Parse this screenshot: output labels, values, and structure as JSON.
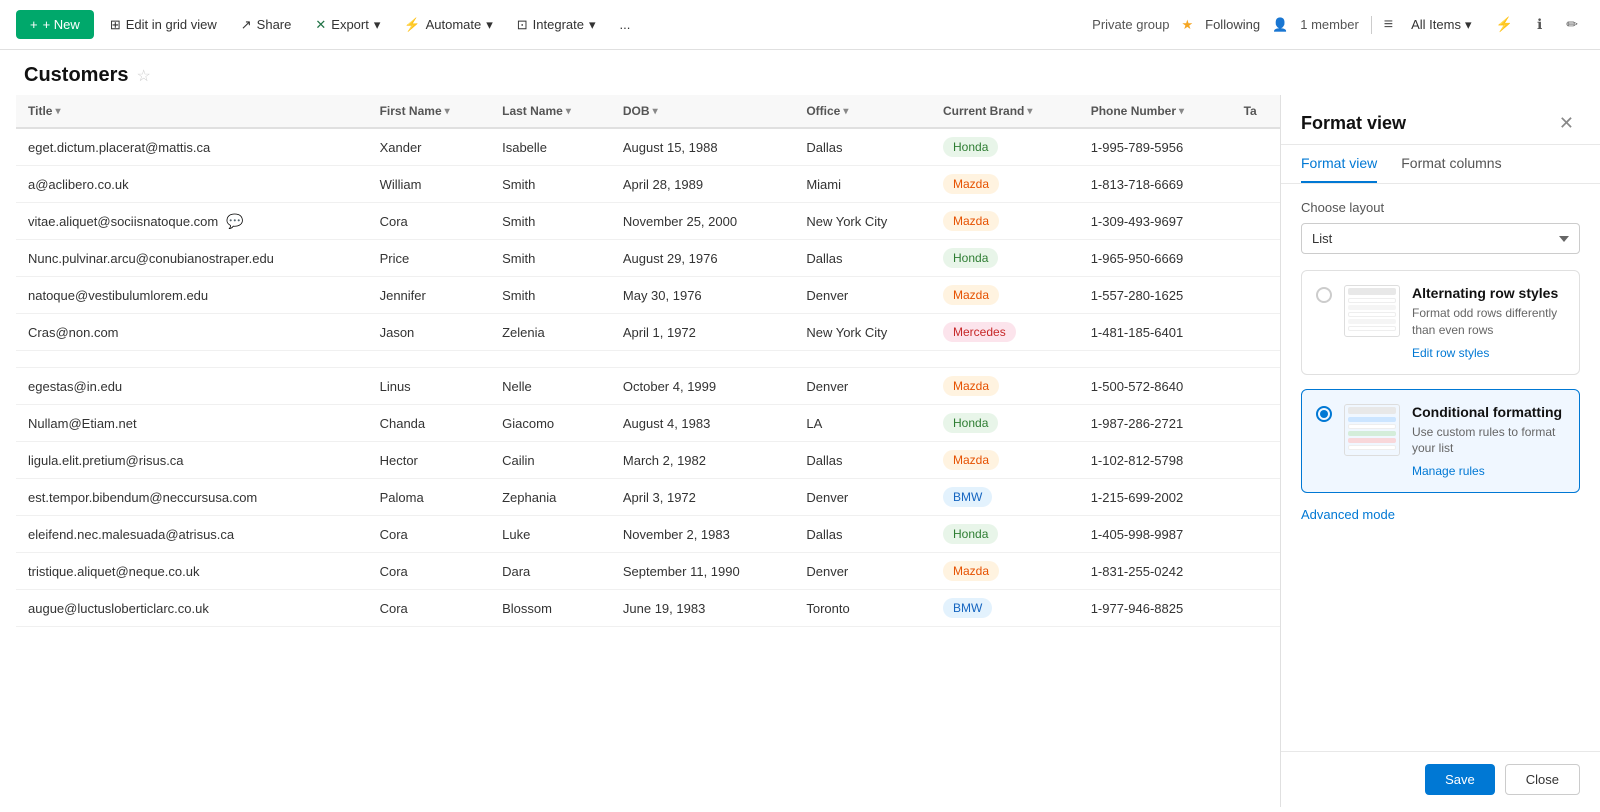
{
  "topbar": {
    "new_label": "+ New",
    "edit_grid": "Edit in grid view",
    "share": "Share",
    "export": "Export",
    "automate": "Automate",
    "integrate": "Integrate",
    "more": "...",
    "private_group": "Private group",
    "following": "Following",
    "member_count": "1 member",
    "all_items": "All Items"
  },
  "page": {
    "title": "Customers"
  },
  "columns": [
    {
      "id": "title",
      "label": "Title"
    },
    {
      "id": "first_name",
      "label": "First Name"
    },
    {
      "id": "last_name",
      "label": "Last Name"
    },
    {
      "id": "dob",
      "label": "DOB"
    },
    {
      "id": "office",
      "label": "Office"
    },
    {
      "id": "current_brand",
      "label": "Current Brand"
    },
    {
      "id": "phone_number",
      "label": "Phone Number"
    },
    {
      "id": "ta",
      "label": "Ta"
    }
  ],
  "rows": [
    {
      "title": "eget.dictum.placerat@mattis.ca",
      "first_name": "Xander",
      "last_name": "Isabelle",
      "dob": "August 15, 1988",
      "office": "Dallas",
      "brand": "Honda",
      "brand_class": "badge-honda",
      "phone": "1-995-789-5956",
      "comment": false
    },
    {
      "title": "a@aclibero.co.uk",
      "first_name": "William",
      "last_name": "Smith",
      "dob": "April 28, 1989",
      "office": "Miami",
      "brand": "Mazda",
      "brand_class": "badge-mazda",
      "phone": "1-813-718-6669",
      "comment": false
    },
    {
      "title": "vitae.aliquet@sociisnatoque.com",
      "first_name": "Cora",
      "last_name": "Smith",
      "dob": "November 25, 2000",
      "office": "New York City",
      "brand": "Mazda",
      "brand_class": "badge-mazda",
      "phone": "1-309-493-9697",
      "comment": true
    },
    {
      "title": "Nunc.pulvinar.arcu@conubianostraper.edu",
      "first_name": "Price",
      "last_name": "Smith",
      "dob": "August 29, 1976",
      "office": "Dallas",
      "brand": "Honda",
      "brand_class": "badge-honda",
      "phone": "1-965-950-6669",
      "comment": false
    },
    {
      "title": "natoque@vestibulumlorem.edu",
      "first_name": "Jennifer",
      "last_name": "Smith",
      "dob": "May 30, 1976",
      "office": "Denver",
      "brand": "Mazda",
      "brand_class": "badge-mazda",
      "phone": "1-557-280-1625",
      "comment": false
    },
    {
      "title": "Cras@non.com",
      "first_name": "Jason",
      "last_name": "Zelenia",
      "dob": "April 1, 1972",
      "office": "New York City",
      "brand": "Mercedes",
      "brand_class": "badge-mercedes",
      "phone": "1-481-185-6401",
      "comment": false
    },
    {
      "title": "",
      "first_name": "",
      "last_name": "",
      "dob": "",
      "office": "",
      "brand": "",
      "brand_class": "",
      "phone": "",
      "comment": false
    },
    {
      "title": "egestas@in.edu",
      "first_name": "Linus",
      "last_name": "Nelle",
      "dob": "October 4, 1999",
      "office": "Denver",
      "brand": "Mazda",
      "brand_class": "badge-mazda",
      "phone": "1-500-572-8640",
      "comment": false
    },
    {
      "title": "Nullam@Etiam.net",
      "first_name": "Chanda",
      "last_name": "Giacomo",
      "dob": "August 4, 1983",
      "office": "LA",
      "brand": "Honda",
      "brand_class": "badge-honda",
      "phone": "1-987-286-2721",
      "comment": false
    },
    {
      "title": "ligula.elit.pretium@risus.ca",
      "first_name": "Hector",
      "last_name": "Cailin",
      "dob": "March 2, 1982",
      "office": "Dallas",
      "brand": "Mazda",
      "brand_class": "badge-mazda",
      "phone": "1-102-812-5798",
      "comment": false
    },
    {
      "title": "est.tempor.bibendum@neccursusa.com",
      "first_name": "Paloma",
      "last_name": "Zephania",
      "dob": "April 3, 1972",
      "office": "Denver",
      "brand": "BMW",
      "brand_class": "badge-bmw",
      "phone": "1-215-699-2002",
      "comment": false
    },
    {
      "title": "eleifend.nec.malesuada@atrisus.ca",
      "first_name": "Cora",
      "last_name": "Luke",
      "dob": "November 2, 1983",
      "office": "Dallas",
      "brand": "Honda",
      "brand_class": "badge-honda",
      "phone": "1-405-998-9987",
      "comment": false
    },
    {
      "title": "tristique.aliquet@neque.co.uk",
      "first_name": "Cora",
      "last_name": "Dara",
      "dob": "September 11, 1990",
      "office": "Denver",
      "brand": "Mazda",
      "brand_class": "badge-mazda",
      "phone": "1-831-255-0242",
      "comment": false
    },
    {
      "title": "augue@luctusloberticlarc.co.uk",
      "first_name": "Cora",
      "last_name": "Blossom",
      "dob": "June 19, 1983",
      "office": "Toronto",
      "brand": "BMW",
      "brand_class": "badge-bmw",
      "phone": "1-977-946-8825",
      "comment": false
    }
  ],
  "format_panel": {
    "title": "Format view",
    "close_label": "✕",
    "tabs": [
      {
        "id": "format-view",
        "label": "Format view"
      },
      {
        "id": "format-columns",
        "label": "Format columns"
      }
    ],
    "active_tab": "Format view",
    "choose_layout_label": "Choose layout",
    "layout_value": "List",
    "options": [
      {
        "id": "alternating",
        "title": "Alternating row styles",
        "desc": "Format odd rows differently than even rows",
        "link": "Edit row styles",
        "selected": false
      },
      {
        "id": "conditional",
        "title": "Conditional formatting",
        "desc": "Use custom rules to format your list",
        "link": "Manage rules",
        "selected": true
      }
    ],
    "advanced_mode": "Advanced mode",
    "save_label": "Save",
    "close_btn_label": "Close"
  }
}
